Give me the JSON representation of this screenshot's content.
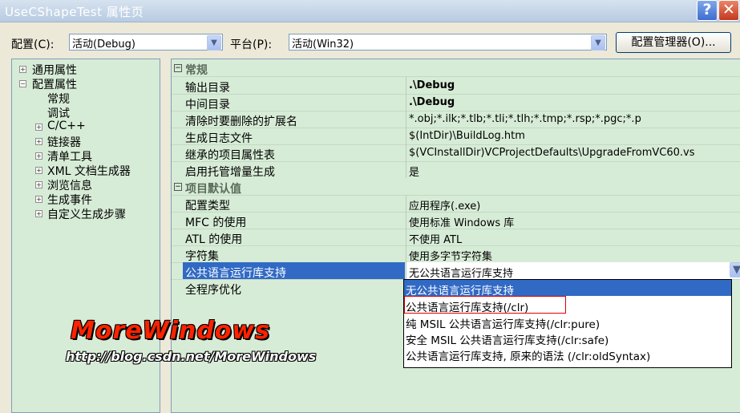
{
  "window": {
    "title": "UseCShapeTest 属性页",
    "help": "?",
    "close": "✕"
  },
  "toolbar": {
    "config_label": "配置(C):",
    "config_value": "活动(Debug)",
    "platform_label": "平台(P):",
    "platform_value": "活动(Win32)",
    "manager_button": "配置管理器(O)..."
  },
  "tree": {
    "items": [
      {
        "label": "通用属性",
        "expander": "+"
      },
      {
        "label": "配置属性",
        "expander": "−"
      },
      {
        "label": "常规"
      },
      {
        "label": "调试"
      },
      {
        "label": "C/C++",
        "expander": "+"
      },
      {
        "label": "链接器",
        "expander": "+"
      },
      {
        "label": "清单工具",
        "expander": "+"
      },
      {
        "label": "XML 文档生成器",
        "expander": "+"
      },
      {
        "label": "浏览信息",
        "expander": "+"
      },
      {
        "label": "生成事件",
        "expander": "+"
      },
      {
        "label": "自定义生成步骤",
        "expander": "+"
      }
    ]
  },
  "grid": {
    "categories": [
      {
        "name": "常规"
      },
      {
        "name": "项目默认值"
      }
    ],
    "rows": [
      {
        "name": "输出目录",
        "value": ".\\Debug"
      },
      {
        "name": "中间目录",
        "value": ".\\Debug"
      },
      {
        "name": "清除时要删除的扩展名",
        "value": "*.obj;*.ilk;*.tlb;*.tli;*.tlh;*.tmp;*.rsp;*.pgc;*.p"
      },
      {
        "name": "生成日志文件",
        "value": "$(IntDir)\\BuildLog.htm"
      },
      {
        "name": "继承的项目属性表",
        "value": "$(VCInstallDir)VCProjectDefaults\\UpgradeFromVC60.vs"
      },
      {
        "name": "启用托管增量生成",
        "value": "是"
      },
      {
        "name": "配置类型",
        "value": "应用程序(.exe)"
      },
      {
        "name": "MFC 的使用",
        "value": "使用标准 Windows 库"
      },
      {
        "name": "ATL 的使用",
        "value": "不使用 ATL"
      },
      {
        "name": "字符集",
        "value": "使用多字节字符集"
      },
      {
        "name": "公共语言运行库支持",
        "value": "无公共语言运行库支持"
      },
      {
        "name": "全程序优化",
        "value": ""
      }
    ]
  },
  "dropdown": {
    "options": [
      "无公共语言运行库支持",
      "公共语言运行库支持(/clr)",
      "纯 MSIL 公共语言运行库支持(/clr:pure)",
      "安全 MSIL 公共语言运行库支持(/clr:safe)",
      "公共语言运行库支持, 原来的语法 (/clr:oldSyntax)"
    ],
    "selected_index": 0
  },
  "watermark": {
    "title": "MoreWindows",
    "url": "http://blog.csdn.net/MoreWindows"
  },
  "colors": {
    "selection": "#316ac5",
    "panel_bg": "#d7ecd7",
    "highlight_box": "#e00000"
  }
}
